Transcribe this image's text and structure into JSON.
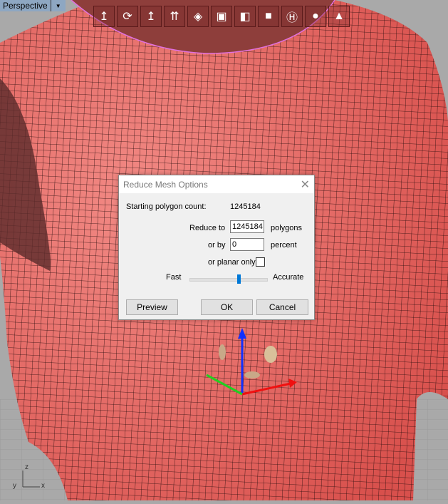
{
  "viewport": {
    "name": "Perspective",
    "axes": {
      "z": "z",
      "y": "y",
      "x": "x"
    }
  },
  "toolbar": {
    "icons": [
      "gumball-icon",
      "rotate-view-icon",
      "move-gumball-icon",
      "multi-gumball-icon",
      "box-corner-icon",
      "box-edge-icon",
      "box-face-icon",
      "box-solid-icon",
      "hide-icon",
      "shaded-sphere-icon",
      "cone-icon"
    ]
  },
  "dialog": {
    "title": "Reduce Mesh Options",
    "starting_label": "Starting polygon count:",
    "starting_value": "1245184",
    "reduce_to_label": "Reduce to",
    "reduce_to_value": "1245184",
    "polygons_label": "polygons",
    "or_by_label": "or by",
    "or_by_value": "0",
    "percent_label": "percent",
    "planar_label": "or planar only",
    "planar_checked": false,
    "fast_label": "Fast",
    "accurate_label": "Accurate",
    "slider_value": 0.64,
    "preview_label": "Preview",
    "ok_label": "OK",
    "cancel_label": "Cancel"
  },
  "colors": {
    "mesh": "#e8605c",
    "accent": "#0078d7"
  }
}
